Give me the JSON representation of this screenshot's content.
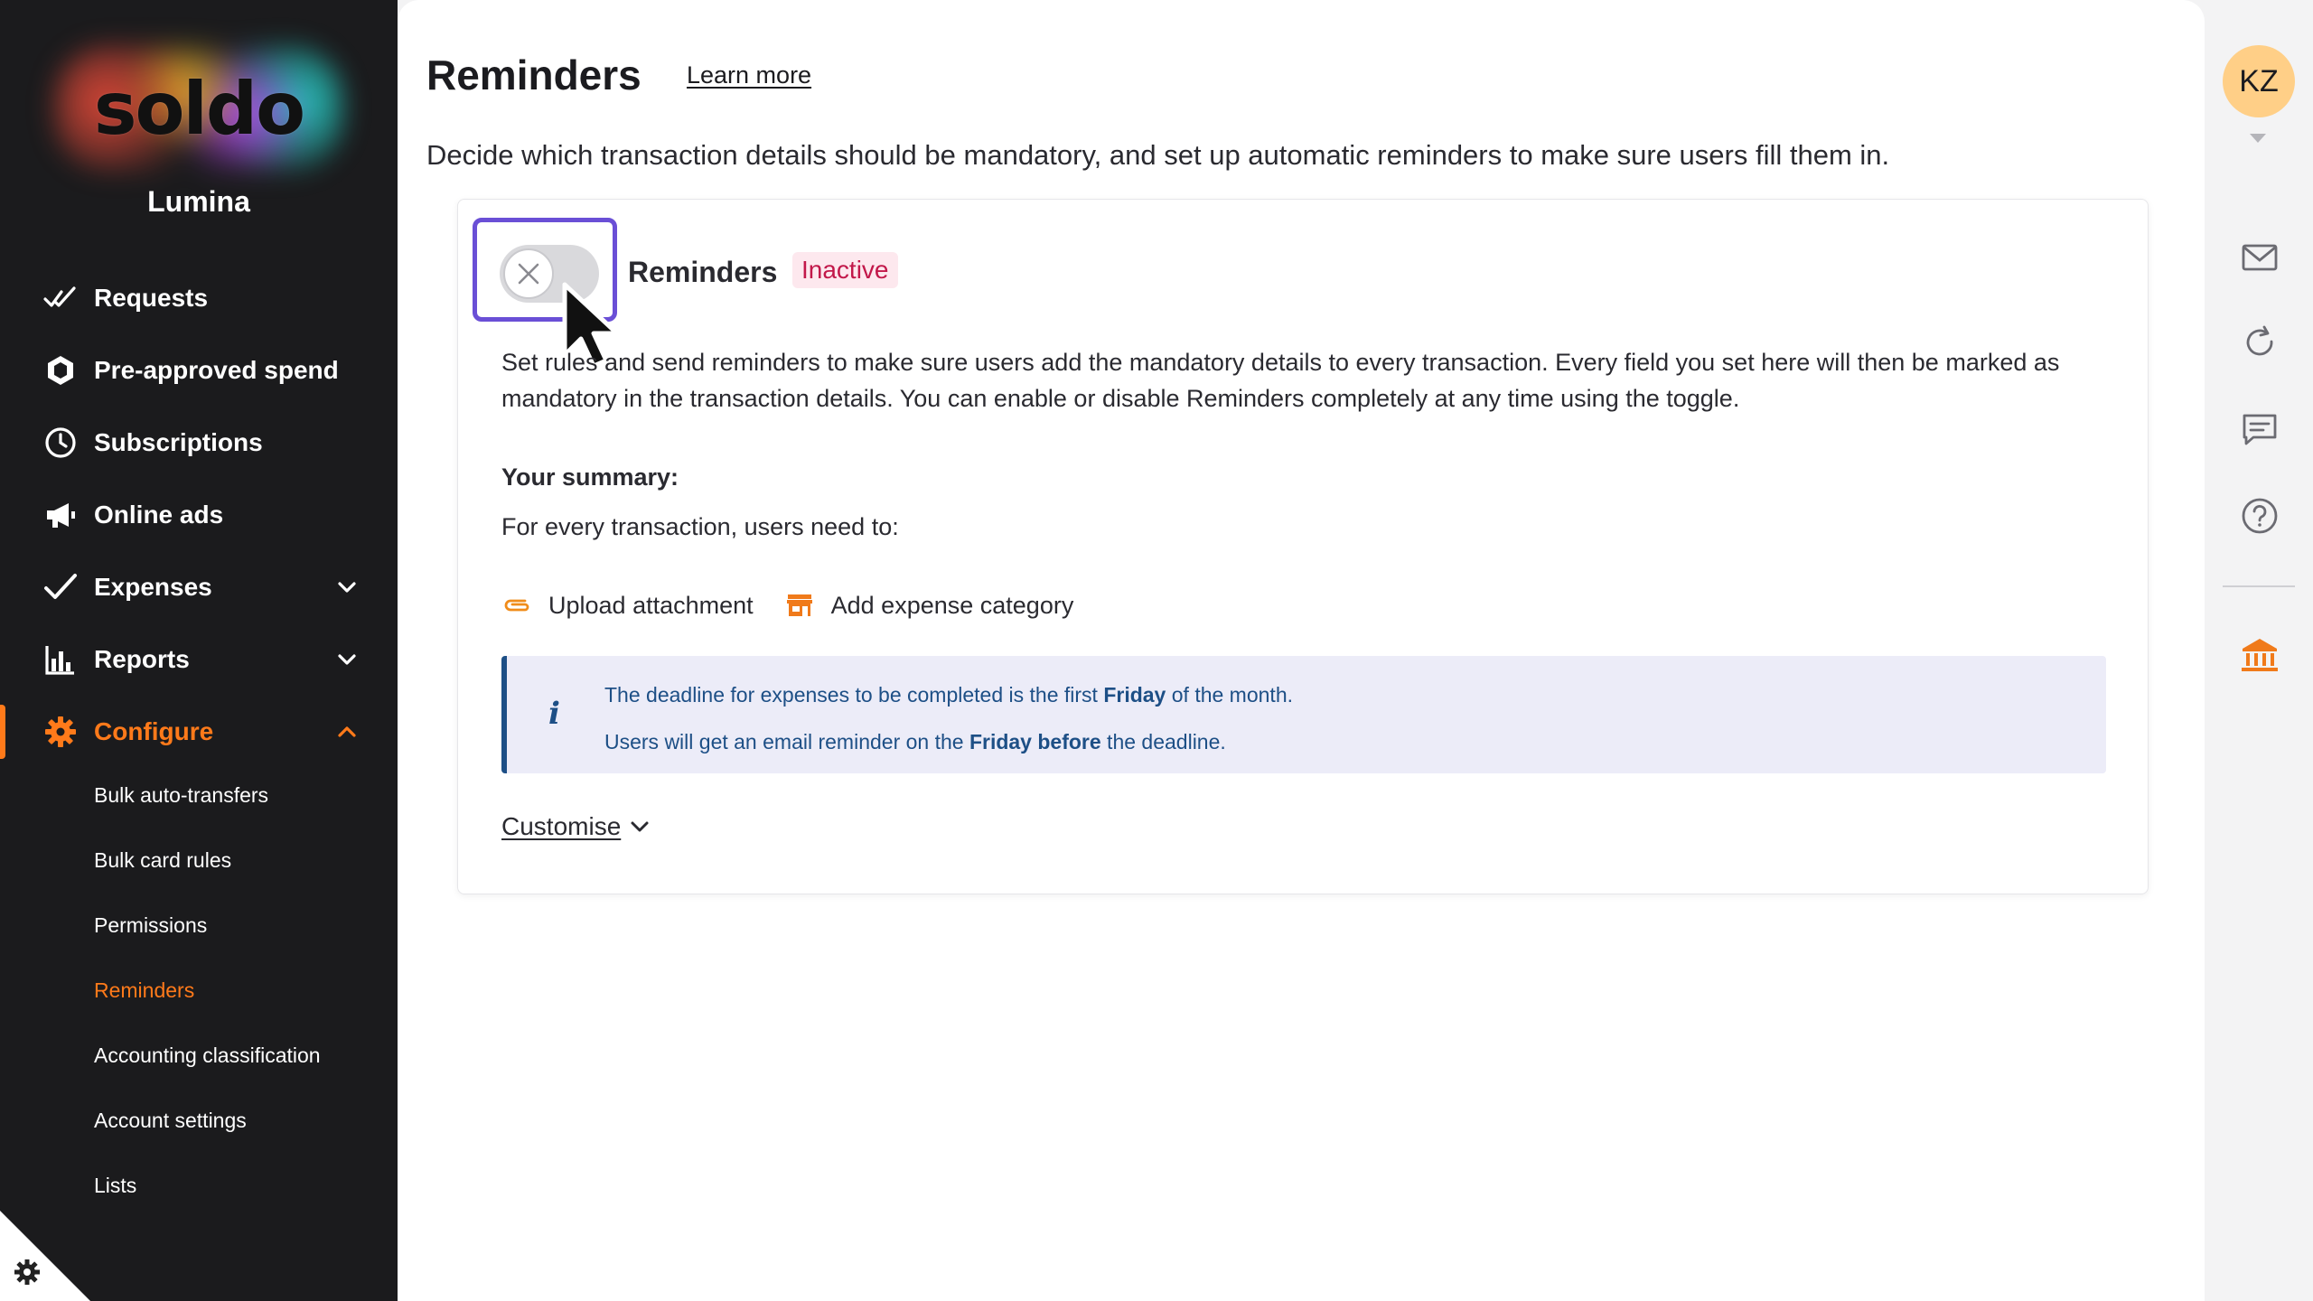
{
  "sidebar": {
    "logo_text": "soldo",
    "org_name": "Lumina",
    "nav": [
      {
        "label": "Requests",
        "icon": "double-check-icon"
      },
      {
        "label": "Pre-approved spend",
        "icon": "hexagon-icon"
      },
      {
        "label": "Subscriptions",
        "icon": "clock-icon"
      },
      {
        "label": "Online ads",
        "icon": "megaphone-icon"
      },
      {
        "label": "Expenses",
        "icon": "check-icon",
        "expandable": true
      },
      {
        "label": "Reports",
        "icon": "bar-chart-icon",
        "expandable": true
      },
      {
        "label": "Configure",
        "icon": "gear-icon",
        "expandable": true,
        "active": true
      }
    ],
    "sub_nav": [
      {
        "label": "Bulk auto-transfers"
      },
      {
        "label": "Bulk card rules"
      },
      {
        "label": "Permissions"
      },
      {
        "label": "Reminders",
        "active": true
      },
      {
        "label": "Accounting classification"
      },
      {
        "label": "Account settings"
      },
      {
        "label": "Lists"
      }
    ],
    "accent_color": "#ff7a1a"
  },
  "page": {
    "title": "Reminders",
    "learn_more": "Learn more",
    "description": "Decide which transaction details should be mandatory, and set up automatic reminders to make sure users fill them in."
  },
  "card": {
    "toggle_state": "off",
    "title": "Reminders",
    "status_badge": "Inactive",
    "description": "Set rules and send reminders to make sure users add the mandatory details to every transaction. Every field you set here will then be marked as mandatory in the transaction details. You can enable or disable Reminders completely at any time using the toggle.",
    "summary_title": "Your summary:",
    "summary_sub": "For every transaction, users need to:",
    "requirements": [
      {
        "label": "Upload attachment",
        "icon": "paperclip-icon"
      },
      {
        "label": "Add expense category",
        "icon": "store-icon"
      }
    ],
    "info": {
      "line1_pre": "The deadline for expenses to be completed is the first ",
      "line1_bold": "Friday",
      "line1_post": " of the month.",
      "line2_pre": "Users will get an email reminder on the ",
      "line2_bold": "Friday before",
      "line2_post": " the deadline."
    },
    "customise": "Customise"
  },
  "rail": {
    "avatar_initials": "KZ",
    "icons": [
      "mail-icon",
      "refresh-icon",
      "chat-icon",
      "help-icon",
      "bank-icon"
    ]
  }
}
